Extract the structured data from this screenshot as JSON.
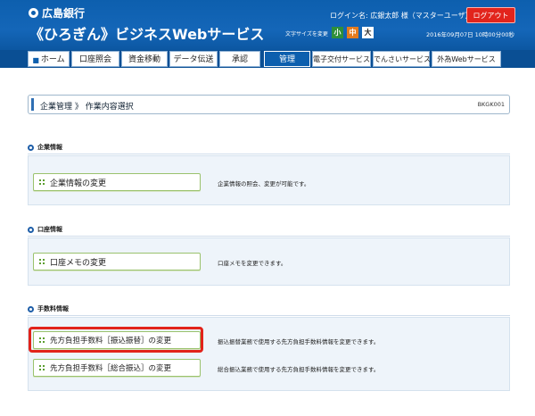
{
  "header": {
    "bank_name": "広島銀行",
    "service_name": "《ひろぎん》ビジネスWebサービス",
    "login_info": "ログイン名: 広銀太郎 様（マスターユーザ）",
    "logout_label": "ログアウト",
    "font_size_label": "文字サイズを変更",
    "font_small": "小",
    "font_medium": "中",
    "font_large": "大",
    "datetime": "2016年09月07日 10時00分00秒"
  },
  "nav": {
    "home": "ホーム",
    "tabs": [
      "口座照会",
      "資金移動",
      "データ伝送",
      "承認",
      "管理",
      "電子交付サービス",
      "でんさいサービス",
      "外為Webサービス"
    ],
    "active": "管理"
  },
  "page": {
    "title": "企業管理 》 作業内容選択",
    "code": "BKGK001"
  },
  "sections": [
    {
      "heading": "企業情報",
      "items": [
        {
          "label": "企業情報の変更",
          "description": "企業情報の照会、変更が可能です。"
        }
      ]
    },
    {
      "heading": "口座情報",
      "items": [
        {
          "label": "口座メモの変更",
          "description": "口座メモを変更できます。"
        }
      ]
    },
    {
      "heading": "手数料情報",
      "items": [
        {
          "label": "先方負担手数料［振込振替］の変更",
          "description": "振込振替業務で使用する先方負担手数料情報を変更できます。"
        },
        {
          "label": "先方負担手数料［総合振込］の変更",
          "description": "総合振込業務で使用する先方負担手数料情報を変更できます。"
        }
      ]
    }
  ],
  "colors": {
    "header_blue": "#0d5fae",
    "logout_red": "#e2241c",
    "button_border_green": "#9ac26d",
    "highlight_red": "#e2231a"
  }
}
